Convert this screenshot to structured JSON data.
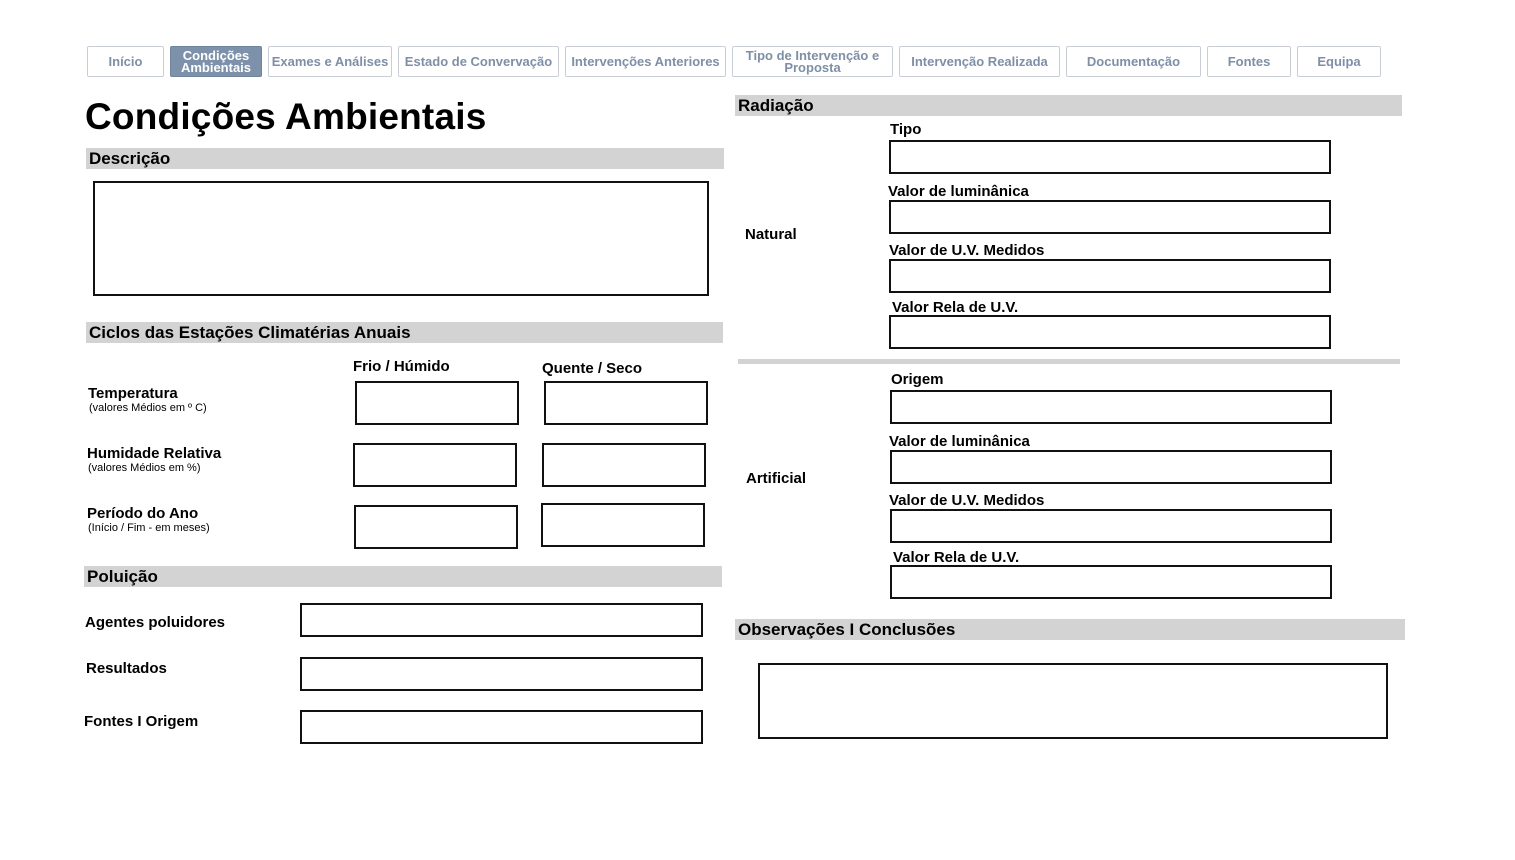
{
  "tabs": [
    {
      "label": "Início"
    },
    {
      "label": "Condições Ambientais"
    },
    {
      "label": "Exames e Análises"
    },
    {
      "label": "Estado de Convervação"
    },
    {
      "label": "Intervenções Anteriores"
    },
    {
      "label": "Tipo de Intervenção e Proposta"
    },
    {
      "label": "Intervenção Realizada"
    },
    {
      "label": "Documentação"
    },
    {
      "label": "Fontes"
    },
    {
      "label": "Equipa"
    }
  ],
  "page": {
    "title": "Condições Ambientais"
  },
  "descricao": {
    "heading": "Descrição"
  },
  "ciclos": {
    "heading": "Ciclos das Estações Climatérias Anuais",
    "col_frio": "Frio / Húmido",
    "col_quente": "Quente / Seco",
    "rows": [
      {
        "label": "Temperatura",
        "sub": "(valores Médios em º C)"
      },
      {
        "label": "Humidade Relativa",
        "sub": "(valores Médios em %)"
      },
      {
        "label": "Período do Ano",
        "sub": "(Início / Fim - em meses)"
      }
    ]
  },
  "poluicao": {
    "heading": "Poluição",
    "fields": [
      {
        "label": "Agentes poluidores"
      },
      {
        "label": "Resultados"
      },
      {
        "label": "Fontes I Origem"
      }
    ]
  },
  "radiacao": {
    "heading": "Radiação",
    "natural": {
      "label": "Natural",
      "fields": [
        "Tipo",
        "Valor de luminânica",
        "Valor de U.V. Medidos",
        "Valor Rela de U.V."
      ]
    },
    "artificial": {
      "label": "Artificial",
      "fields": [
        "Origem",
        "Valor de luminânica",
        "Valor de U.V. Medidos",
        "Valor Rela de U.V."
      ]
    }
  },
  "observacoes": {
    "heading": "Observações I Conclusões"
  }
}
